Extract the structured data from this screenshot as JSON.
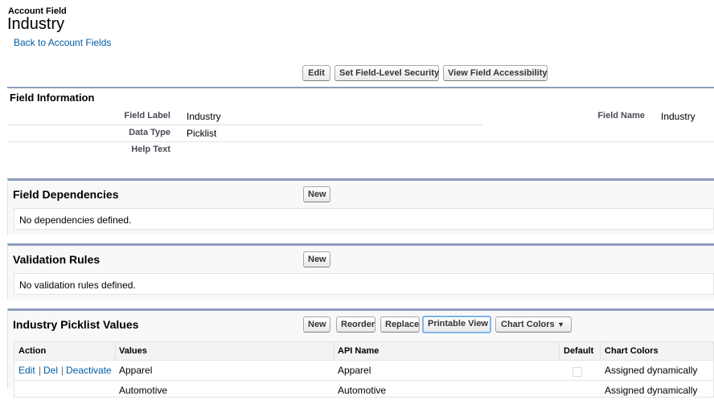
{
  "header": {
    "breadcrumb": "Account Field",
    "title": "Industry",
    "back_link": "Back to Account Fields"
  },
  "top_buttons": {
    "edit": "Edit",
    "field_level_security": "Set Field-Level Security",
    "view_accessibility": "View Field Accessibility"
  },
  "field_info": {
    "title": "Field Information",
    "field_label_label": "Field Label",
    "field_label_value": "Industry",
    "data_type_label": "Data Type",
    "data_type_value": "Picklist",
    "help_text_label": "Help Text",
    "help_text_value": "",
    "field_name_label": "Field Name",
    "field_name_value": "Industry"
  },
  "dependencies": {
    "title": "Field Dependencies",
    "new_button": "New",
    "empty_text": "No dependencies defined."
  },
  "validation": {
    "title": "Validation Rules",
    "new_button": "New",
    "empty_text": "No validation rules defined."
  },
  "picklist": {
    "title": "Industry Picklist Values",
    "buttons": {
      "new": "New",
      "reorder": "Reorder",
      "replace": "Replace",
      "printable_view": "Printable View",
      "chart_colors": "Chart Colors"
    },
    "columns": {
      "action": "Action",
      "values": "Values",
      "api_name": "API Name",
      "default": "Default",
      "chart_colors": "Chart Colors"
    },
    "rows": [
      {
        "edit": "Edit",
        "sep1": "|",
        "del": "Del",
        "sep2": "|",
        "deactivate": "Deactivate",
        "value": "Apparel",
        "api_name": "Apparel",
        "default": false,
        "chart_color": "Assigned dynamically"
      },
      {
        "value": "Automotive",
        "api_name": "Automotive",
        "chart_color": "Assigned dynamically"
      }
    ]
  },
  "colors": {
    "section_border": "#8e9dbe",
    "link": "#015ba7",
    "focus_ring": "#7fb5e9"
  }
}
